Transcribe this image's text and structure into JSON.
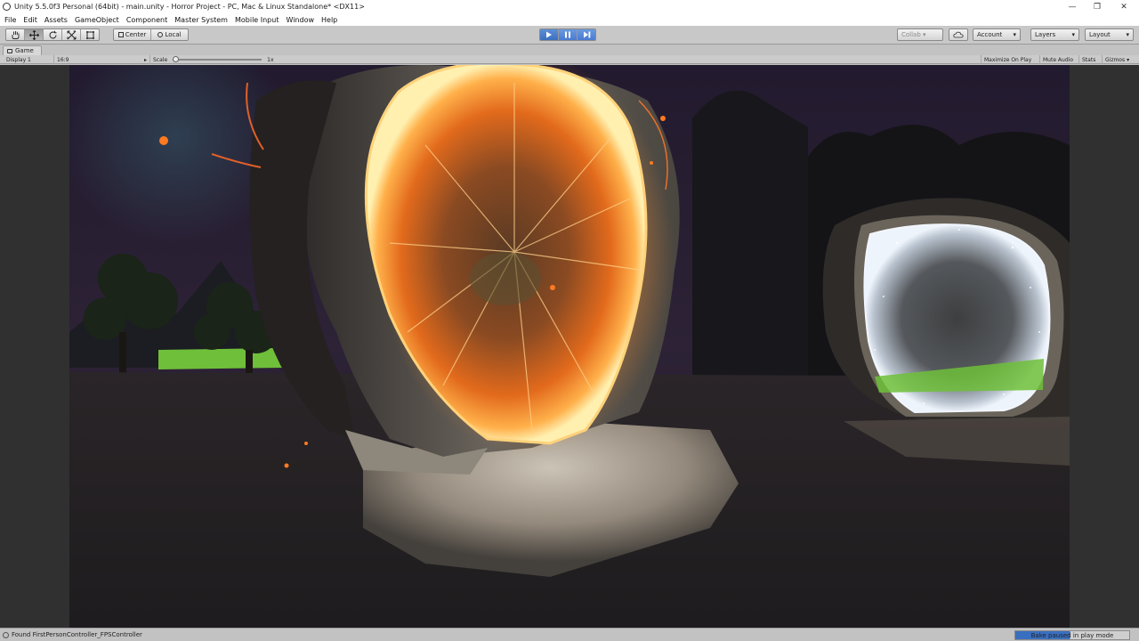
{
  "window": {
    "title": "Unity 5.5.0f3 Personal (64bit) - main.unity - Horror Project - PC, Mac & Linux Standalone* <DX11>",
    "controls": [
      "—",
      "❐",
      "✕"
    ]
  },
  "menu": [
    "File",
    "Edit",
    "Assets",
    "GameObject",
    "Component",
    "Master System",
    "Mobile Input",
    "Window",
    "Help"
  ],
  "toolbar": {
    "tools": [
      "hand-tool-icon",
      "move-tool-icon",
      "rotate-tool-icon",
      "scale-tool-icon",
      "rect-tool-icon"
    ],
    "pivot_label": "Center",
    "space_label": "Local",
    "play_controls": [
      "play-icon",
      "pause-icon",
      "step-icon"
    ],
    "collab_label": "Collab ▾",
    "cloud_icon": "cloud-icon",
    "account_label": "Account",
    "layers_label": "Layers",
    "layout_label": "Layout"
  },
  "game_view": {
    "tab_label": "Game",
    "display_label": "Display 1",
    "aspect_label": "16:9",
    "scale_label": "Scale",
    "scale_value": "1x",
    "scale_fraction": 0.0,
    "toggles": [
      "Maximize On Play",
      "Mute Audio",
      "Stats",
      "Gizmos"
    ]
  },
  "status": {
    "message": "Found FirstPersonController_FPSController",
    "bake_text": "Bake paused in play mode",
    "bake_progress": 0.48
  },
  "colors": {
    "accent": "#3a6fc0",
    "portal_fire": "#ff8a2a",
    "portal_ice": "#dfe8f5",
    "sky": "#241a30",
    "grass": "#6fbf3a"
  }
}
